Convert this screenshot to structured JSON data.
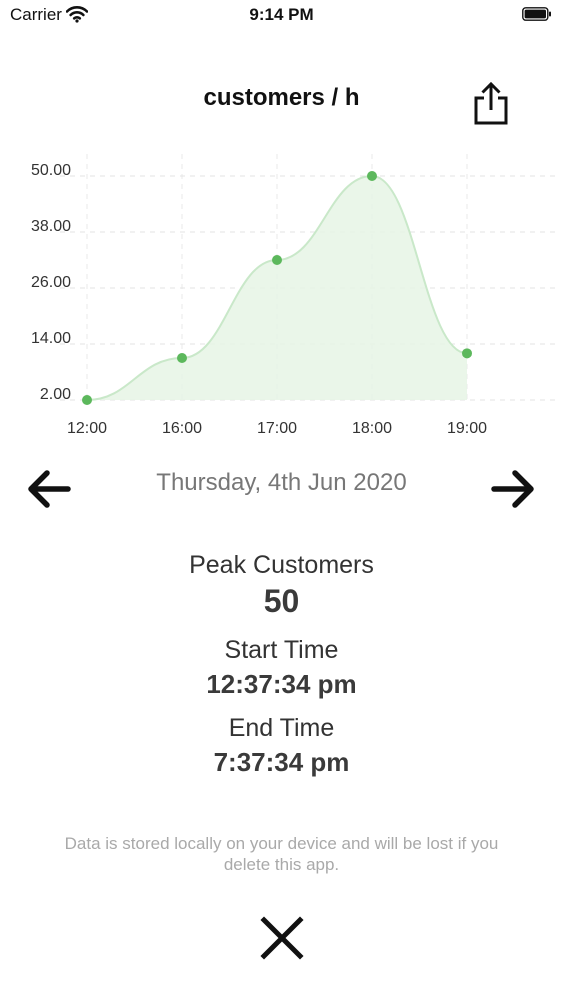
{
  "status_bar": {
    "carrier": "Carrier",
    "time": "9:14 PM",
    "icons": [
      "wifi-icon",
      "battery-icon"
    ]
  },
  "header": {
    "title": "customers / h",
    "share_icon": "share-icon"
  },
  "chart_data": {
    "type": "area",
    "x": [
      "12:00",
      "16:00",
      "17:00",
      "18:00",
      "19:00"
    ],
    "values": [
      2,
      11,
      32,
      50,
      12
    ],
    "yticks": [
      "50.00",
      "38.00",
      "26.00",
      "14.00",
      "2.00"
    ],
    "ylim": [
      2,
      50
    ],
    "grid": true,
    "line_color": "#c9e8c9",
    "fill_color": "#e6f5e5",
    "point_color": "#5cb85c",
    "title": "",
    "xlabel": "",
    "ylabel": ""
  },
  "date_nav": {
    "date": "Thursday, 4th Jun 2020",
    "prev_icon": "arrow-left-icon",
    "next_icon": "arrow-right-icon"
  },
  "stats": {
    "peak_label": "Peak Customers",
    "peak_value": "50",
    "start_label": "Start Time",
    "start_value": "12:37:34 pm",
    "end_label": "End Time",
    "end_value": "7:37:34 pm"
  },
  "footer": {
    "note": "Data is stored locally on your device and will be lost if you delete this app.",
    "close_icon": "close-icon"
  }
}
